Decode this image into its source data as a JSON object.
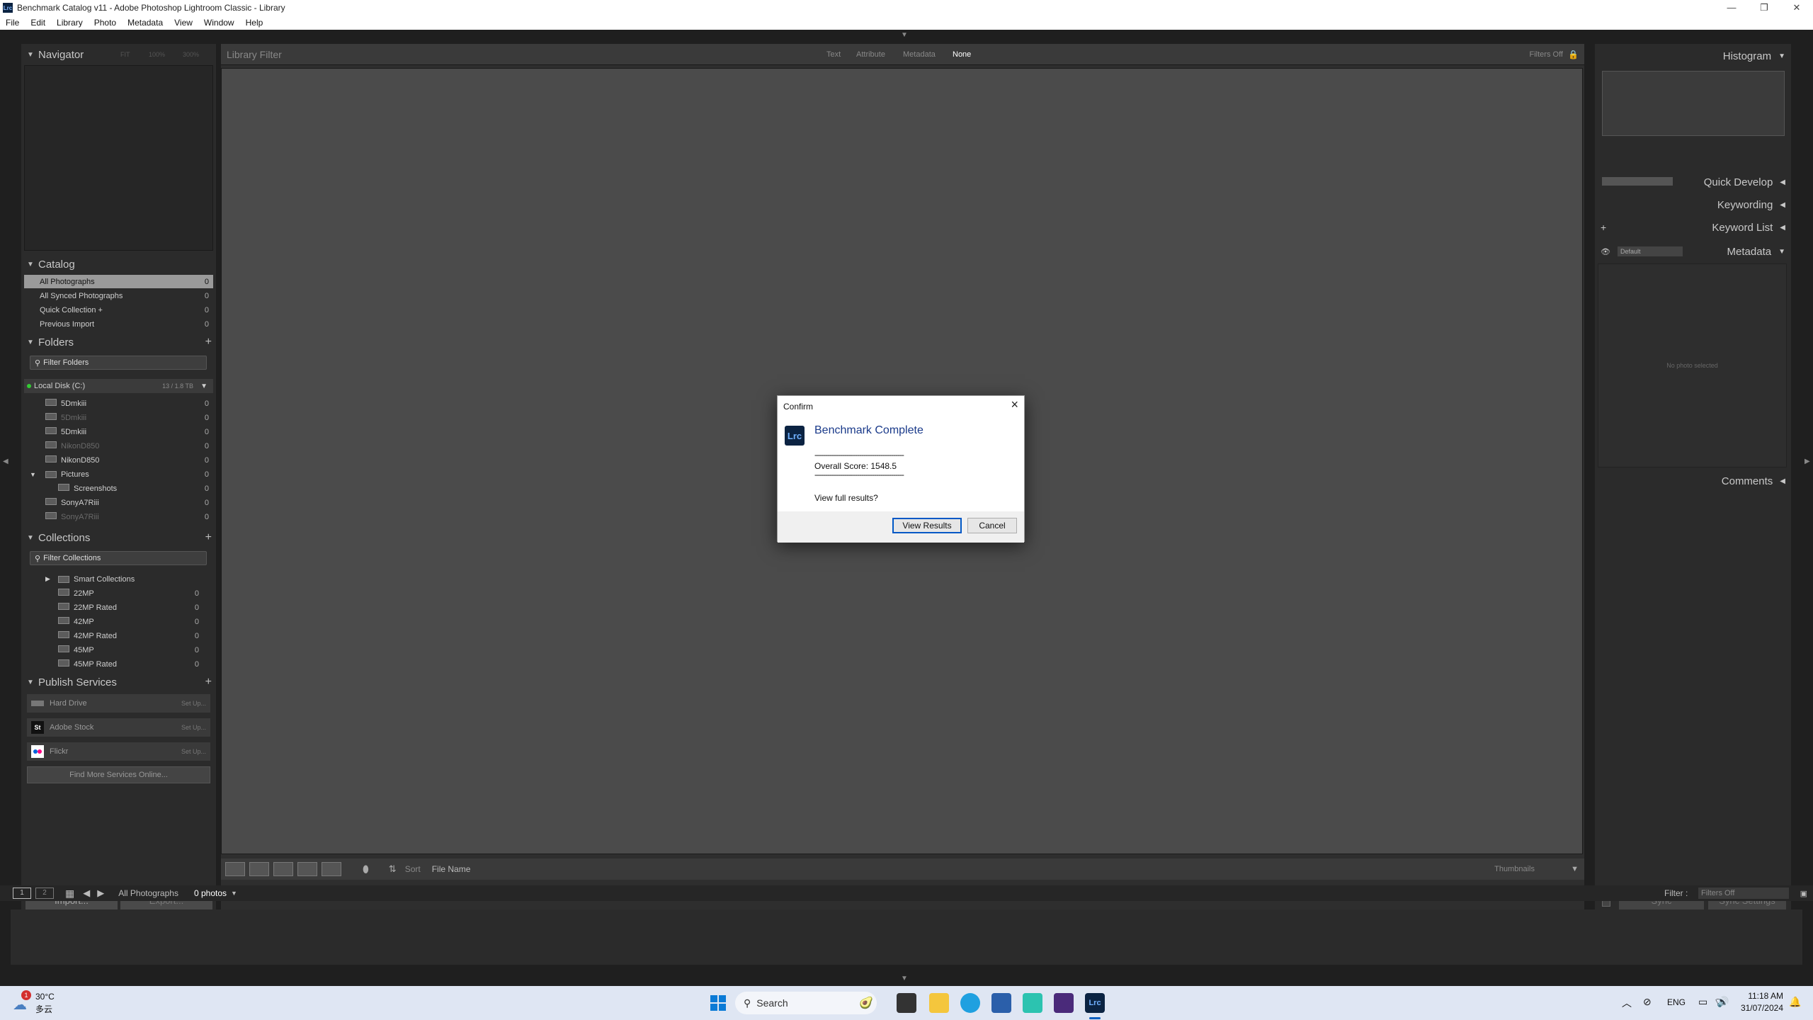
{
  "window": {
    "title": "Benchmark Catalog v11 - Adobe Photoshop Lightroom Classic - Library",
    "app_icon": "Lrc",
    "controls": [
      "minimize-icon",
      "restore-icon",
      "close-icon"
    ]
  },
  "menu": [
    "File",
    "Edit",
    "Library",
    "Photo",
    "Metadata",
    "View",
    "Window",
    "Help"
  ],
  "navigator": {
    "title": "Navigator",
    "zoom": [
      "FIT",
      "100%",
      "300%"
    ]
  },
  "catalog": {
    "title": "Catalog",
    "items": [
      {
        "label": "All Photographs",
        "count": "0"
      },
      {
        "label": "All Synced Photographs",
        "count": "0"
      },
      {
        "label": "Quick Collection  +",
        "count": "0"
      },
      {
        "label": "Previous Import",
        "count": "0"
      }
    ]
  },
  "folders": {
    "title": "Folders",
    "filter": "Filter Folders",
    "disk": {
      "label": "Local Disk (C:)",
      "size": "13 / 1.8 TB"
    },
    "items": [
      {
        "label": "5Dmkiii",
        "count": "0"
      },
      {
        "label": "5Dmkiii",
        "count": "0"
      },
      {
        "label": "5Dmkiii",
        "count": "0"
      },
      {
        "label": "NikonD850",
        "count": "0"
      },
      {
        "label": "NikonD850",
        "count": "0"
      },
      {
        "label": "Pictures",
        "count": "0"
      },
      {
        "label": "Screenshots",
        "count": "0"
      },
      {
        "label": "SonyA7Riii",
        "count": "0"
      },
      {
        "label": "SonyA7Riii",
        "count": "0"
      }
    ]
  },
  "collections": {
    "title": "Collections",
    "filter": "Filter Collections",
    "items": [
      {
        "label": "Smart Collections",
        "count": ""
      },
      {
        "label": "22MP",
        "count": "0"
      },
      {
        "label": "22MP Rated",
        "count": "0"
      },
      {
        "label": "42MP",
        "count": "0"
      },
      {
        "label": "42MP Rated",
        "count": "0"
      },
      {
        "label": "45MP",
        "count": "0"
      },
      {
        "label": "45MP Rated",
        "count": "0"
      }
    ]
  },
  "publish": {
    "title": "Publish Services",
    "services": [
      {
        "label": "Hard Drive",
        "action": "Set Up..."
      },
      {
        "label": "Adobe Stock",
        "action": "Set Up..."
      },
      {
        "label": "Flickr",
        "action": "Set Up..."
      }
    ],
    "find_more": "Find More Services Online..."
  },
  "left_buttons": {
    "import": "Import...",
    "export": "Export..."
  },
  "filter_bar": {
    "title": "Library Filter",
    "tabs": [
      "Text",
      "Attribute",
      "Metadata",
      "None"
    ],
    "filters_off": "Filters Off"
  },
  "toolbar": {
    "sort_label": "Sort",
    "sort_value": "File Name",
    "thumbnails": "Thumbnails"
  },
  "right_panel": {
    "histogram": "Histogram",
    "quick_develop": "Quick Develop",
    "keywording": "Keywording",
    "keyword_list": "Keyword List",
    "metadata": "Metadata",
    "metadata_preset": "Default",
    "no_photo": "No photo selected",
    "comments": "Comments",
    "sync": "Sync",
    "sync_settings": "Sync Settings"
  },
  "filmstrip_bar": {
    "page1": "1",
    "page2": "2",
    "source": "All Photographs",
    "count": "0 photos",
    "filter_label": "Filter :",
    "filter_value": "Filters Off"
  },
  "dialog": {
    "title": "Confirm",
    "heading": "Benchmark Complete",
    "divider": "------------------------------------------",
    "score": "Overall Score: 1548.5",
    "question": "View full results?",
    "primary": "View Results",
    "cancel": "Cancel"
  },
  "taskbar": {
    "weather_temp": "30°C",
    "weather_desc": "多云",
    "weather_badge": "1",
    "search": "Search",
    "lang": "ENG",
    "time": "11:18 AM",
    "date": "31/07/2024"
  }
}
